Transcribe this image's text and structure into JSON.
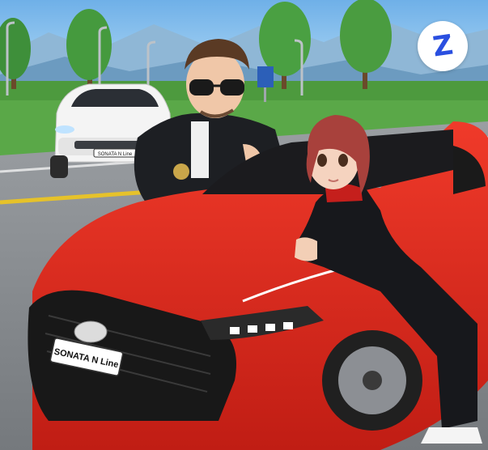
{
  "app_logo": {
    "letter": "Z",
    "color": "#2a4fe0"
  },
  "plates": {
    "front": "SONATA N Line",
    "rear": "SONATA N Line"
  },
  "scene": {
    "subjects": [
      "man-avatar",
      "woman-avatar",
      "red-sedan",
      "white-sedan"
    ],
    "colors": {
      "sky": "#7ab8ea",
      "grass": "#5aa848",
      "road": "#8e9296",
      "car_red": "#e0281f",
      "car_white": "#f2f2f2"
    }
  }
}
